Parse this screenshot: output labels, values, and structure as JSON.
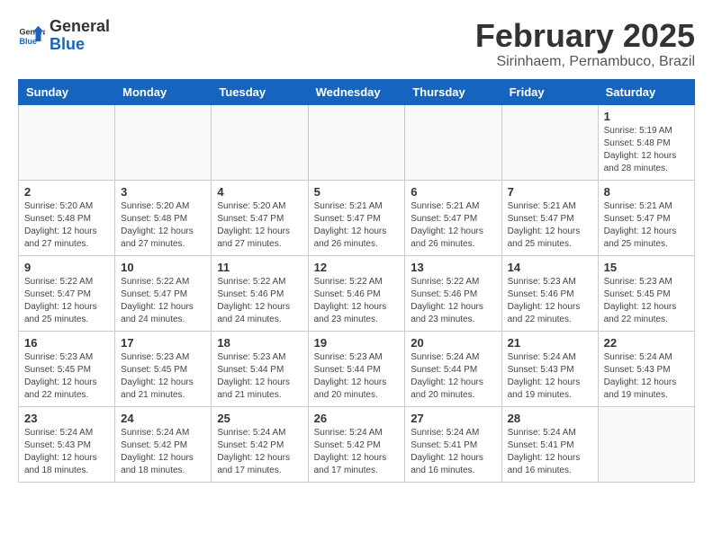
{
  "logo": {
    "line1": "General",
    "line2": "Blue"
  },
  "title": "February 2025",
  "subtitle": "Sirinhaem, Pernambuco, Brazil",
  "days_of_week": [
    "Sunday",
    "Monday",
    "Tuesday",
    "Wednesday",
    "Thursday",
    "Friday",
    "Saturday"
  ],
  "weeks": [
    [
      {
        "day": "",
        "info": ""
      },
      {
        "day": "",
        "info": ""
      },
      {
        "day": "",
        "info": ""
      },
      {
        "day": "",
        "info": ""
      },
      {
        "day": "",
        "info": ""
      },
      {
        "day": "",
        "info": ""
      },
      {
        "day": "1",
        "info": "Sunrise: 5:19 AM\nSunset: 5:48 PM\nDaylight: 12 hours\nand 28 minutes."
      }
    ],
    [
      {
        "day": "2",
        "info": "Sunrise: 5:20 AM\nSunset: 5:48 PM\nDaylight: 12 hours\nand 27 minutes."
      },
      {
        "day": "3",
        "info": "Sunrise: 5:20 AM\nSunset: 5:48 PM\nDaylight: 12 hours\nand 27 minutes."
      },
      {
        "day": "4",
        "info": "Sunrise: 5:20 AM\nSunset: 5:47 PM\nDaylight: 12 hours\nand 27 minutes."
      },
      {
        "day": "5",
        "info": "Sunrise: 5:21 AM\nSunset: 5:47 PM\nDaylight: 12 hours\nand 26 minutes."
      },
      {
        "day": "6",
        "info": "Sunrise: 5:21 AM\nSunset: 5:47 PM\nDaylight: 12 hours\nand 26 minutes."
      },
      {
        "day": "7",
        "info": "Sunrise: 5:21 AM\nSunset: 5:47 PM\nDaylight: 12 hours\nand 25 minutes."
      },
      {
        "day": "8",
        "info": "Sunrise: 5:21 AM\nSunset: 5:47 PM\nDaylight: 12 hours\nand 25 minutes."
      }
    ],
    [
      {
        "day": "9",
        "info": "Sunrise: 5:22 AM\nSunset: 5:47 PM\nDaylight: 12 hours\nand 25 minutes."
      },
      {
        "day": "10",
        "info": "Sunrise: 5:22 AM\nSunset: 5:47 PM\nDaylight: 12 hours\nand 24 minutes."
      },
      {
        "day": "11",
        "info": "Sunrise: 5:22 AM\nSunset: 5:46 PM\nDaylight: 12 hours\nand 24 minutes."
      },
      {
        "day": "12",
        "info": "Sunrise: 5:22 AM\nSunset: 5:46 PM\nDaylight: 12 hours\nand 23 minutes."
      },
      {
        "day": "13",
        "info": "Sunrise: 5:22 AM\nSunset: 5:46 PM\nDaylight: 12 hours\nand 23 minutes."
      },
      {
        "day": "14",
        "info": "Sunrise: 5:23 AM\nSunset: 5:46 PM\nDaylight: 12 hours\nand 22 minutes."
      },
      {
        "day": "15",
        "info": "Sunrise: 5:23 AM\nSunset: 5:45 PM\nDaylight: 12 hours\nand 22 minutes."
      }
    ],
    [
      {
        "day": "16",
        "info": "Sunrise: 5:23 AM\nSunset: 5:45 PM\nDaylight: 12 hours\nand 22 minutes."
      },
      {
        "day": "17",
        "info": "Sunrise: 5:23 AM\nSunset: 5:45 PM\nDaylight: 12 hours\nand 21 minutes."
      },
      {
        "day": "18",
        "info": "Sunrise: 5:23 AM\nSunset: 5:44 PM\nDaylight: 12 hours\nand 21 minutes."
      },
      {
        "day": "19",
        "info": "Sunrise: 5:23 AM\nSunset: 5:44 PM\nDaylight: 12 hours\nand 20 minutes."
      },
      {
        "day": "20",
        "info": "Sunrise: 5:24 AM\nSunset: 5:44 PM\nDaylight: 12 hours\nand 20 minutes."
      },
      {
        "day": "21",
        "info": "Sunrise: 5:24 AM\nSunset: 5:43 PM\nDaylight: 12 hours\nand 19 minutes."
      },
      {
        "day": "22",
        "info": "Sunrise: 5:24 AM\nSunset: 5:43 PM\nDaylight: 12 hours\nand 19 minutes."
      }
    ],
    [
      {
        "day": "23",
        "info": "Sunrise: 5:24 AM\nSunset: 5:43 PM\nDaylight: 12 hours\nand 18 minutes."
      },
      {
        "day": "24",
        "info": "Sunrise: 5:24 AM\nSunset: 5:42 PM\nDaylight: 12 hours\nand 18 minutes."
      },
      {
        "day": "25",
        "info": "Sunrise: 5:24 AM\nSunset: 5:42 PM\nDaylight: 12 hours\nand 17 minutes."
      },
      {
        "day": "26",
        "info": "Sunrise: 5:24 AM\nSunset: 5:42 PM\nDaylight: 12 hours\nand 17 minutes."
      },
      {
        "day": "27",
        "info": "Sunrise: 5:24 AM\nSunset: 5:41 PM\nDaylight: 12 hours\nand 16 minutes."
      },
      {
        "day": "28",
        "info": "Sunrise: 5:24 AM\nSunset: 5:41 PM\nDaylight: 12 hours\nand 16 minutes."
      },
      {
        "day": "",
        "info": ""
      }
    ]
  ]
}
